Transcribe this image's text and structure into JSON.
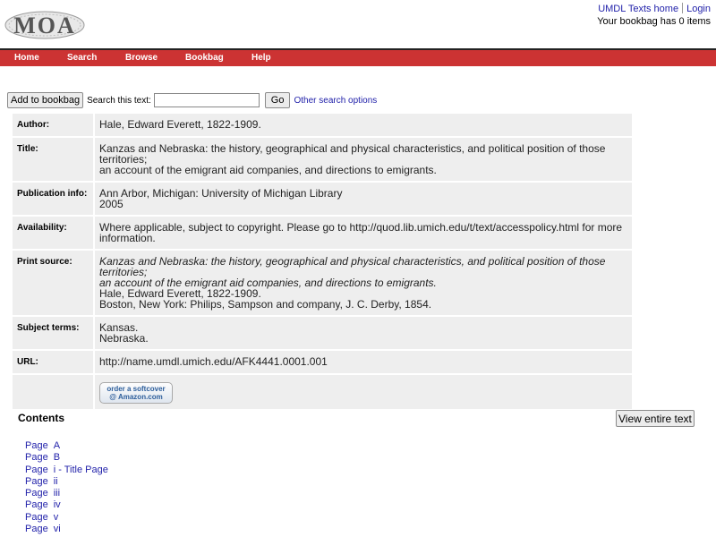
{
  "header": {
    "logo_text": "MOA",
    "links": {
      "texts_home": "UMDL Texts home",
      "login": "Login"
    },
    "bookbag_status": "Your bookbag has 0 items"
  },
  "nav": {
    "items": [
      "Home",
      "Search",
      "Browse",
      "Bookbag",
      "Help"
    ]
  },
  "toolbar": {
    "add_to_bookbag": "Add to bookbag",
    "search_label": "Search this text:",
    "search_value": "",
    "go": "Go",
    "other_options": "Other search options"
  },
  "record": {
    "author_label": "Author:",
    "author": "Hale, Edward Everett, 1822-1909.",
    "title_label": "Title:",
    "title_line1": "Kanzas and Nebraska: the history, geographical and physical characteristics, and political position of those territories;",
    "title_line2": "an account of the emigrant aid companies, and directions to emigrants.",
    "pub_label": "Publication info:",
    "pub_line1": "Ann Arbor, Michigan: University of Michigan Library",
    "pub_line2": "2005",
    "avail_label": "Availability:",
    "avail_line1": "Where applicable, subject to copyright. Please go to http://quod.lib.umich.edu/t/text/accesspolicy.html for more",
    "avail_line2": "information.",
    "print_label": "Print source:",
    "print_line1": "Kanzas and Nebraska: the history, geographical and physical characteristics, and political position of those territories;",
    "print_line2": "an account of the emigrant aid companies, and directions to emigrants.",
    "print_line3": "Hale, Edward Everett, 1822-1909.",
    "print_line4": "Boston, New York: Philips, Sampson and company, J. C. Derby, 1854.",
    "subject_label": "Subject terms:",
    "subject1": "Kansas.",
    "subject2": "Nebraska.",
    "url_label": "URL:",
    "url": "http://name.umdl.umich.edu/AFK4441.0001.001",
    "amazon_line1": "order a softcover",
    "amazon_line2": "@ Amazon.com"
  },
  "contents": {
    "title": "Contents",
    "view_entire": "View entire text",
    "page_word": "Page",
    "pages": [
      "A",
      "B",
      "i - Title Page",
      "ii",
      "iii",
      "iv",
      "v",
      "vi"
    ]
  }
}
